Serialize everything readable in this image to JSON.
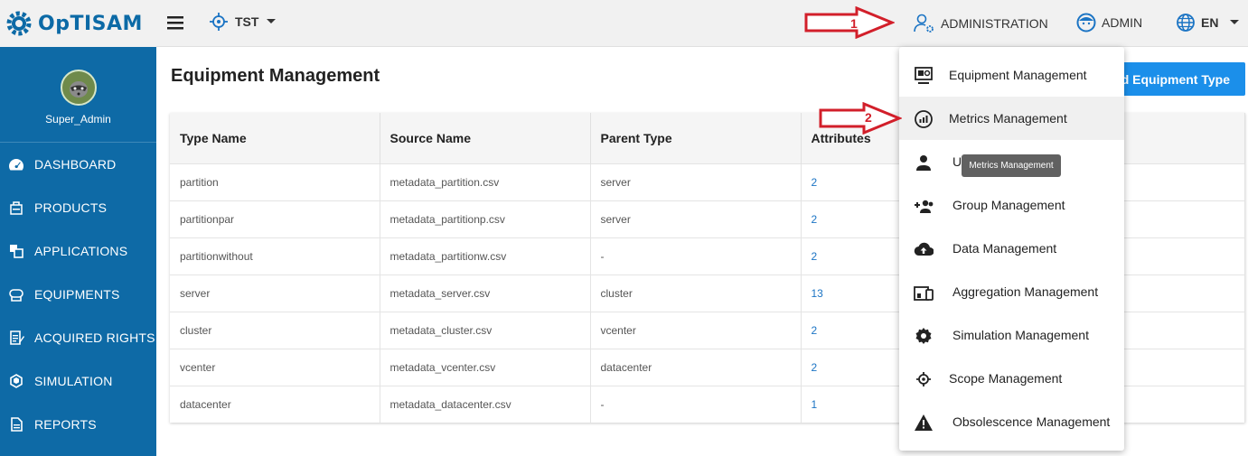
{
  "app": {
    "name": "OpTISAM"
  },
  "header": {
    "scope": "TST",
    "admin_menu": "ADMINISTRATION",
    "user": "ADMIN",
    "lang": "EN"
  },
  "sidebar": {
    "username": "Super_Admin",
    "items": [
      {
        "label": "DASHBOARD",
        "icon": "dashboard-icon"
      },
      {
        "label": "PRODUCTS",
        "icon": "products-icon"
      },
      {
        "label": "APPLICATIONS",
        "icon": "applications-icon"
      },
      {
        "label": "EQUIPMENTS",
        "icon": "equipments-icon"
      },
      {
        "label": "ACQUIRED RIGHTS",
        "icon": "acquired-rights-icon"
      },
      {
        "label": "SIMULATION",
        "icon": "simulation-icon"
      },
      {
        "label": "REPORTS",
        "icon": "reports-icon"
      }
    ]
  },
  "main": {
    "title": "Equipment Management",
    "add_button": "dd Equipment Type",
    "table": {
      "headers": [
        "Type Name",
        "Source Name",
        "Parent Type",
        "Attributes"
      ],
      "rows": [
        [
          "partition",
          "metadata_partition.csv",
          "server",
          "2"
        ],
        [
          "partitionpar",
          "metadata_partitionp.csv",
          "server",
          "2"
        ],
        [
          "partitionwithout",
          "metadata_partitionw.csv",
          "-",
          "2"
        ],
        [
          "server",
          "metadata_server.csv",
          "cluster",
          "13"
        ],
        [
          "cluster",
          "metadata_cluster.csv",
          "vcenter",
          "2"
        ],
        [
          "vcenter",
          "metadata_vcenter.csv",
          "datacenter",
          "2"
        ],
        [
          "datacenter",
          "metadata_datacenter.csv",
          "-",
          "1"
        ]
      ]
    }
  },
  "admin_dropdown": {
    "items": [
      {
        "label": "Equipment Management",
        "icon": "equipment-icon"
      },
      {
        "label": "Metrics Management",
        "icon": "metrics-icon"
      },
      {
        "label": "U",
        "icon": "user-icon"
      },
      {
        "label": "Group Management",
        "icon": "group-icon"
      },
      {
        "label": "Data Management",
        "icon": "cloud-upload-icon"
      },
      {
        "label": "Aggregation Management",
        "icon": "aggregation-icon"
      },
      {
        "label": "Simulation Management",
        "icon": "gear-icon"
      },
      {
        "label": "Scope Management",
        "icon": "scope-icon"
      },
      {
        "label": "Obsolescence Management",
        "icon": "warning-icon"
      }
    ],
    "tooltip": "Metrics Management"
  },
  "annotations": {
    "step1": "1",
    "step2": "2"
  },
  "colors": {
    "sidebar": "#0e6aa6",
    "accent": "#1b8fea",
    "arrow": "#d21f2a"
  }
}
